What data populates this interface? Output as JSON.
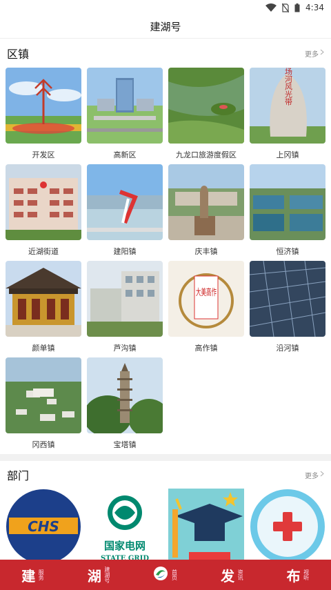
{
  "status": {
    "time": "4:34"
  },
  "header": {
    "title": "建湖号"
  },
  "towns": {
    "title": "区镇",
    "more": "更多",
    "items": [
      {
        "label": "开发区"
      },
      {
        "label": "高新区"
      },
      {
        "label": "九龙口旅游度假区"
      },
      {
        "label": "上冈镇"
      },
      {
        "label": "近湖街道"
      },
      {
        "label": "建阳镇"
      },
      {
        "label": "庆丰镇"
      },
      {
        "label": "恒济镇"
      },
      {
        "label": "颜单镇"
      },
      {
        "label": "芦沟镇"
      },
      {
        "label": "高作镇"
      },
      {
        "label": "沿河镇"
      },
      {
        "label": "冈西镇"
      },
      {
        "label": "宝塔镇"
      }
    ],
    "image_text": {
      "shanggang": "串场河风光带",
      "gaozuo": "大美高作",
      "chs": "CHS",
      "grid_cn": "国家电网",
      "grid_en": "STATE GRID"
    }
  },
  "depts": {
    "title": "部门",
    "more": "更多"
  },
  "nav": {
    "items": [
      {
        "big": "建",
        "small": "服务"
      },
      {
        "big": "湖",
        "small": "建湖号"
      },
      {
        "big": "",
        "small": "首页"
      },
      {
        "big": "发",
        "small": "资讯"
      },
      {
        "big": "布",
        "small": "视听"
      }
    ]
  },
  "colors": {
    "nav_bg": "#c8282e",
    "accent_red": "#d62b2b"
  }
}
